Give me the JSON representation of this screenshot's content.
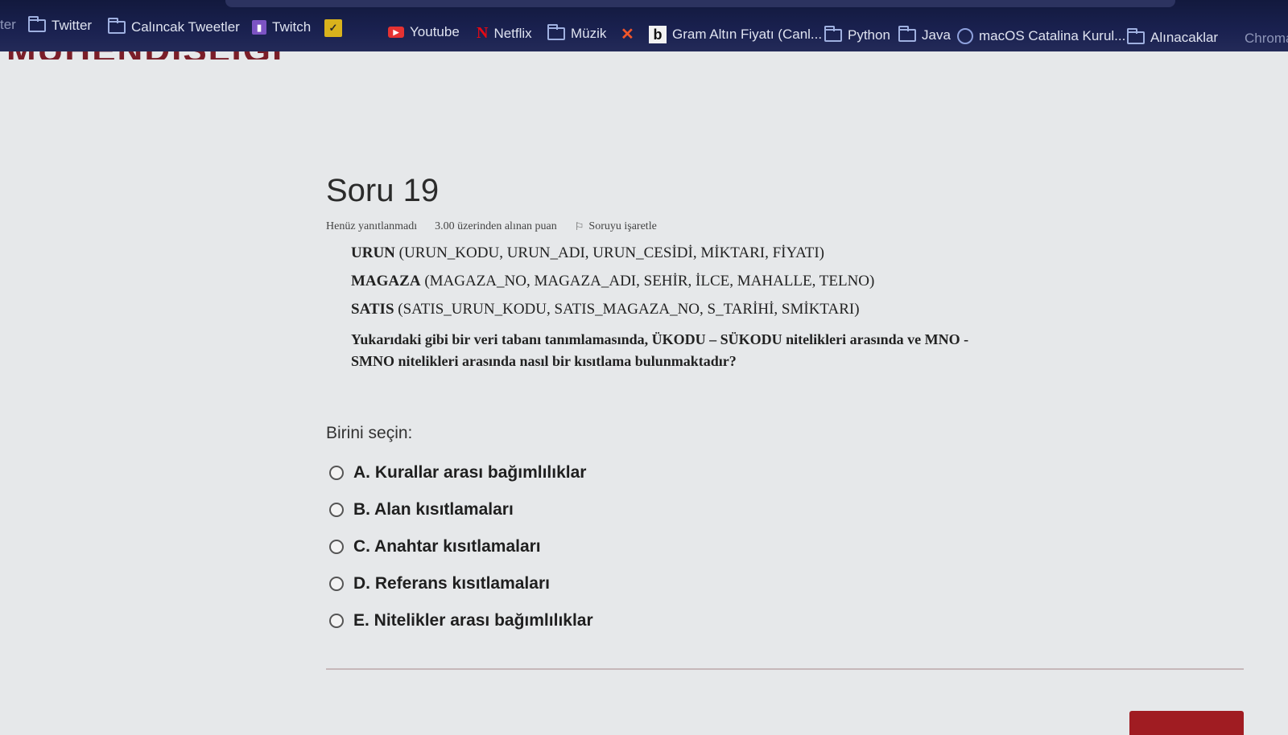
{
  "bookmarks": [
    {
      "label": "ter",
      "icon": "none"
    },
    {
      "label": "Twitter",
      "icon": "folder-icon"
    },
    {
      "label": "Calıncak Tweetler",
      "icon": "folder-icon"
    },
    {
      "label": "Twitch",
      "icon": "twitch-icon"
    },
    {
      "label": "",
      "icon": "yellow-bookmark-icon"
    },
    {
      "label": "Youtube",
      "icon": "youtube-icon"
    },
    {
      "label": "Netflix",
      "icon": "netflix-icon"
    },
    {
      "label": "Müzik",
      "icon": "folder-icon"
    },
    {
      "label": "",
      "icon": "x-bookmark-icon"
    },
    {
      "label": "Gram Altın Fiyatı (Canl...",
      "icon": "b-site-icon"
    },
    {
      "label": "Python",
      "icon": "folder-icon"
    },
    {
      "label": "Java",
      "icon": "folder-icon"
    },
    {
      "label": "macOS Catalina Kurul...",
      "icon": "macos-icon"
    },
    {
      "label": "Alınacaklar",
      "icon": "folder-icon"
    },
    {
      "label": "Chroma",
      "icon": "none"
    }
  ],
  "page_heading": "MÜHENDİSLİĞİ",
  "question": {
    "title": "Soru 19",
    "status": "Henüz yanıtlanmadı",
    "points": "3.00 üzerinden alınan puan",
    "flag_label": "Soruyu işaretle",
    "relations": [
      {
        "name": "URUN",
        "attrs": "(URUN_KODU, URUN_ADI, URUN_CESİDİ, MİKTARI, FİYATI)"
      },
      {
        "name": "MAGAZA",
        "attrs": "(MAGAZA_NO, MAGAZA_ADI, SEHİR, İLCE, MAHALLE, TELNO)"
      },
      {
        "name": "SATIS",
        "attrs": "(SATIS_URUN_KODU,  SATIS_MAGAZA_NO, S_TARİHİ, SMİKTARI)"
      }
    ],
    "text_line1": "Yukarıdaki gibi bir veri tabanı tanımlamasında, ÜKODU – SÜKODU nitelikleri arasında ve MNO -",
    "text_line2": "SMNO nitelikleri arasında nasıl bir kısıtlama bulunmaktadır?"
  },
  "choose_label": "Birini seçin:",
  "options": [
    {
      "label": "A. Kurallar arası bağımlılıklar",
      "selected": false
    },
    {
      "label": "B. Alan kısıtlamaları",
      "selected": false
    },
    {
      "label": "C. Anahtar kısıtlamaları",
      "selected": false
    },
    {
      "label": "D. Referans kısıtlamaları",
      "selected": false
    },
    {
      "label": "E. Nitelikler arası bağımlılıklar",
      "selected": false
    }
  ]
}
